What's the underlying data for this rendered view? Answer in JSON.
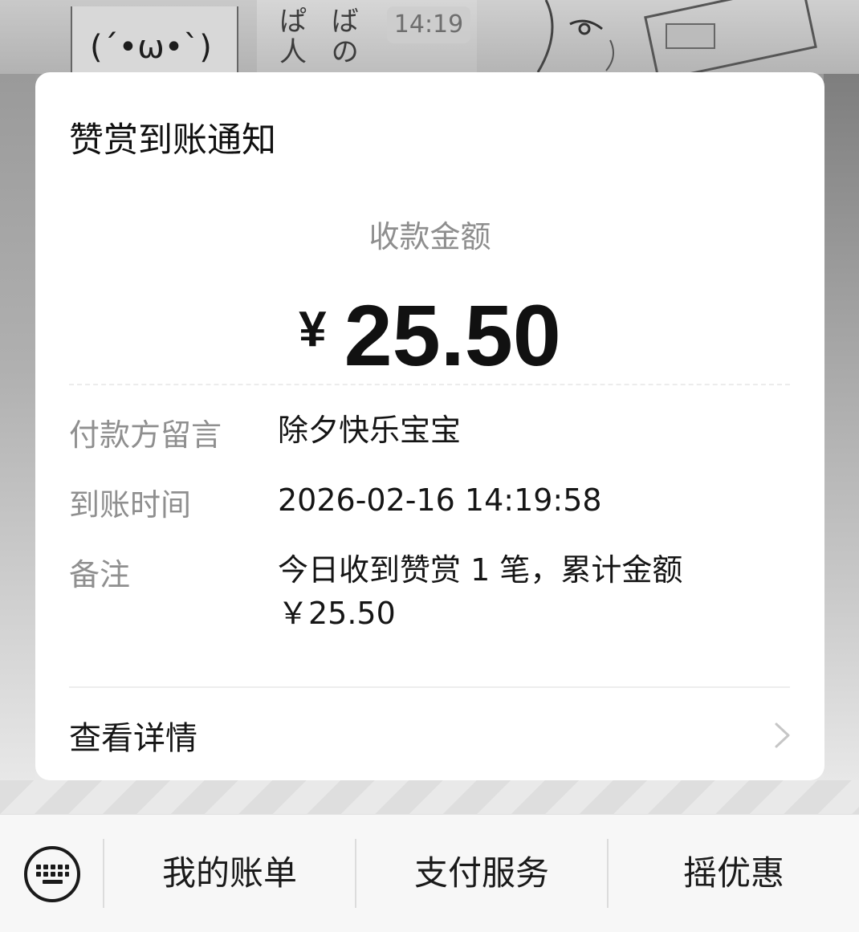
{
  "chat": {
    "timestamp": "14:19"
  },
  "card": {
    "title": "赞赏到账通知",
    "amount_label": "收款金额",
    "amount": {
      "currency": "¥",
      "value": "25.50"
    },
    "rows": [
      {
        "label": "付款方留言",
        "value": "除夕快乐宝宝"
      },
      {
        "label": "到账时间",
        "value": "2026-02-16 14:19:58"
      },
      {
        "label": "备注",
        "value_line1": "今日收到赞赏 1 笔，累计金额",
        "value_line2": "￥25.50"
      }
    ],
    "details_label": "查看详情",
    "details_icon": "chevron-right-icon"
  },
  "bottom_bar": {
    "keyboard_icon": "keyboard-icon",
    "items": [
      {
        "label": "我的账单"
      },
      {
        "label": "支付服务"
      },
      {
        "label": "摇优惠"
      }
    ]
  },
  "colors": {
    "card_bg": "#ffffff",
    "title_text": "#111111",
    "muted_text": "#8f8f8f",
    "bottom_bar_bg": "#f7f7f7"
  }
}
